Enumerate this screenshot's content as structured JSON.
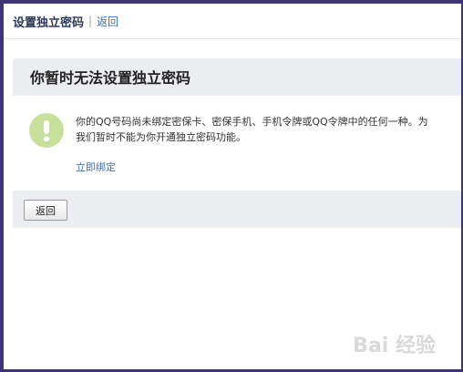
{
  "header": {
    "title": "设置独立密码",
    "separator": "|",
    "back_link": "返回"
  },
  "panel": {
    "title": "你暂时无法设置独立密码",
    "icon": "warning-icon",
    "message_line1": "你的QQ号码尚未绑定密保卡、密保手机、手机令牌或QQ令牌中的任何一种。为",
    "message_line2": "我们暂时不能为你开通独立密码功能。",
    "bind_link": "立即绑定",
    "back_button": "返回"
  },
  "watermark": "Bai 经验"
}
